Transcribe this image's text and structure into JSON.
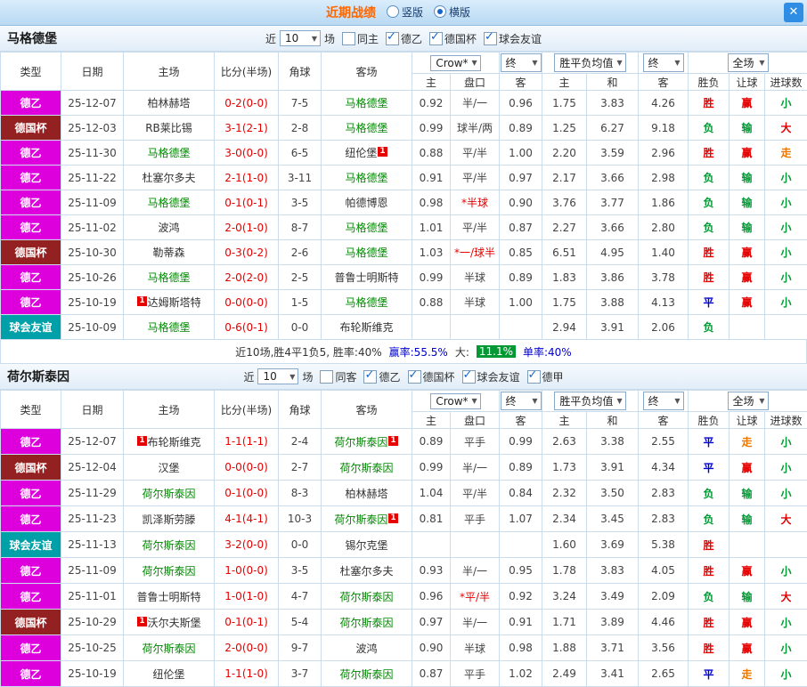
{
  "accent": {
    "score_red": "#e60000",
    "team_green": "#008800",
    "blue": "#0000cc"
  },
  "status_colors": {
    "胜": "#e60000",
    "负": "#009933",
    "平": "#0000cc",
    "赢": "#e60000",
    "输": "#009933",
    "走": "#ee7700",
    "大": "#e60000",
    "小": "#009933"
  },
  "type_styles": {
    "德乙": "#dd00dd",
    "德国杯": "#942121",
    "球会友谊": "#00a0a8"
  },
  "titlebar": {
    "title": "近期战绩",
    "radios": [
      {
        "label": "竖版",
        "selected": false
      },
      {
        "label": "横版",
        "selected": true
      }
    ],
    "close_label": "✕"
  },
  "table_header": {
    "type": "类型",
    "date": "日期",
    "home": "主场",
    "score": "比分(半场)",
    "corner": "角球",
    "away": "客场",
    "odds_select": "Crow*",
    "odds_final": "终",
    "odds_cols": [
      "主",
      "盘口",
      "客"
    ],
    "avg_select": "胜平负均值",
    "avg_final": "终",
    "avg_cols": [
      "主",
      "和",
      "客"
    ],
    "full_select": "全场",
    "result_cols": [
      "胜负",
      "让球",
      "进球数"
    ]
  },
  "sections": [
    {
      "team": "马格德堡",
      "filter": {
        "near": "近",
        "count": "10",
        "unit": "场",
        "checkboxes": [
          {
            "label": "同主",
            "checked": false
          },
          {
            "label": "德乙",
            "checked": true
          },
          {
            "label": "德国杯",
            "checked": true
          },
          {
            "label": "球会友谊",
            "checked": true
          }
        ]
      },
      "rows": [
        {
          "type": "德乙",
          "date": "25-12-07",
          "home": {
            "name": "柏林赫塔",
            "focus": false
          },
          "score": "0-2(0-0)",
          "corner": "7-5",
          "away": {
            "name": "马格德堡",
            "focus": true
          },
          "odds": [
            "0.92",
            "半/一",
            "0.96"
          ],
          "avg": [
            "1.75",
            "3.83",
            "4.26"
          ],
          "result": "胜",
          "let": "赢",
          "goal": "小"
        },
        {
          "type": "德国杯",
          "date": "25-12-03",
          "home": {
            "name": "RB莱比锡",
            "focus": false
          },
          "score": "3-1(2-1)",
          "corner": "2-8",
          "away": {
            "name": "马格德堡",
            "focus": true
          },
          "odds": [
            "0.99",
            "球半/两",
            "0.89"
          ],
          "avg": [
            "1.25",
            "6.27",
            "9.18"
          ],
          "result": "负",
          "let": "输",
          "goal": "大"
        },
        {
          "type": "德乙",
          "date": "25-11-30",
          "home": {
            "name": "马格德堡",
            "focus": true
          },
          "score": "3-0(0-0)",
          "corner": "6-5",
          "away": {
            "name": "纽伦堡",
            "focus": false,
            "badge": "1",
            "badge_pos": "after"
          },
          "odds": [
            "0.88",
            "平/半",
            "1.00"
          ],
          "avg": [
            "2.20",
            "3.59",
            "2.96"
          ],
          "result": "胜",
          "let": "赢",
          "goal": "走"
        },
        {
          "type": "德乙",
          "date": "25-11-22",
          "home": {
            "name": "杜塞尔多夫",
            "focus": false
          },
          "score": "2-1(1-0)",
          "corner": "3-11",
          "away": {
            "name": "马格德堡",
            "focus": true
          },
          "odds": [
            "0.91",
            "平/半",
            "0.97"
          ],
          "avg": [
            "2.17",
            "3.66",
            "2.98"
          ],
          "result": "负",
          "let": "输",
          "goal": "小"
        },
        {
          "type": "德乙",
          "date": "25-11-09",
          "home": {
            "name": "马格德堡",
            "focus": true
          },
          "score": "0-1(0-1)",
          "corner": "3-5",
          "away": {
            "name": "帕德博恩",
            "focus": false
          },
          "odds": [
            "0.98",
            "*半球",
            "0.90"
          ],
          "avg": [
            "3.76",
            "3.77",
            "1.86"
          ],
          "result": "负",
          "let": "输",
          "goal": "小"
        },
        {
          "type": "德乙",
          "date": "25-11-02",
          "home": {
            "name": "波鸿",
            "focus": false
          },
          "score": "2-0(1-0)",
          "corner": "8-7",
          "away": {
            "name": "马格德堡",
            "focus": true
          },
          "odds": [
            "1.01",
            "平/半",
            "0.87"
          ],
          "avg": [
            "2.27",
            "3.66",
            "2.80"
          ],
          "result": "负",
          "let": "输",
          "goal": "小"
        },
        {
          "type": "德国杯",
          "date": "25-10-30",
          "home": {
            "name": "勒蒂森",
            "focus": false
          },
          "score": "0-3(0-2)",
          "corner": "2-6",
          "away": {
            "name": "马格德堡",
            "focus": true
          },
          "odds": [
            "1.03",
            "*一/球半",
            "0.85"
          ],
          "avg": [
            "6.51",
            "4.95",
            "1.40"
          ],
          "result": "胜",
          "let": "赢",
          "goal": "小"
        },
        {
          "type": "德乙",
          "date": "25-10-26",
          "home": {
            "name": "马格德堡",
            "focus": true
          },
          "score": "2-0(2-0)",
          "corner": "2-5",
          "away": {
            "name": "普鲁士明斯特",
            "focus": false
          },
          "odds": [
            "0.99",
            "半球",
            "0.89"
          ],
          "avg": [
            "1.83",
            "3.86",
            "3.78"
          ],
          "result": "胜",
          "let": "赢",
          "goal": "小"
        },
        {
          "type": "德乙",
          "date": "25-10-19",
          "home": {
            "name": "达姆斯塔特",
            "focus": false,
            "badge": "1",
            "badge_pos": "before"
          },
          "score": "0-0(0-0)",
          "corner": "1-5",
          "away": {
            "name": "马格德堡",
            "focus": true
          },
          "odds": [
            "0.88",
            "半球",
            "1.00"
          ],
          "avg": [
            "1.75",
            "3.88",
            "4.13"
          ],
          "result": "平",
          "let": "赢",
          "goal": "小"
        },
        {
          "type": "球会友谊",
          "date": "25-10-09",
          "home": {
            "name": "马格德堡",
            "focus": true
          },
          "score": "0-6(0-1)",
          "corner": "0-0",
          "away": {
            "name": "布轮斯维克",
            "focus": false
          },
          "odds": [
            "",
            "",
            ""
          ],
          "avg": [
            "2.94",
            "3.91",
            "2.06"
          ],
          "result": "负",
          "let": "",
          "goal": ""
        }
      ],
      "summary": [
        {
          "text": "近10场,胜4平1负5, 胜率:40%",
          "color": "#333333"
        },
        {
          "text": "赢率:55.5%",
          "color": "#0000cc"
        },
        {
          "text": "大:",
          "color": "#333333"
        },
        {
          "text": "11.1%",
          "color": "#ffffff",
          "bg": "#009933"
        },
        {
          "text": "单率:40%",
          "color": "#0000cc"
        }
      ]
    },
    {
      "team": "荷尔斯泰因",
      "filter": {
        "near": "近",
        "count": "10",
        "unit": "场",
        "checkboxes": [
          {
            "label": "同客",
            "checked": false
          },
          {
            "label": "德乙",
            "checked": true
          },
          {
            "label": "德国杯",
            "checked": true
          },
          {
            "label": "球会友谊",
            "checked": true
          },
          {
            "label": "德甲",
            "checked": true
          }
        ]
      },
      "rows": [
        {
          "type": "德乙",
          "date": "25-12-07",
          "home": {
            "name": "布轮斯维克",
            "focus": false,
            "badge": "1",
            "badge_pos": "before"
          },
          "score": "1-1(1-1)",
          "corner": "2-4",
          "away": {
            "name": "荷尔斯泰因",
            "focus": true,
            "badge": "1",
            "badge_pos": "after"
          },
          "odds": [
            "0.89",
            "平手",
            "0.99"
          ],
          "avg": [
            "2.63",
            "3.38",
            "2.55"
          ],
          "result": "平",
          "let": "走",
          "goal": "小"
        },
        {
          "type": "德国杯",
          "date": "25-12-04",
          "home": {
            "name": "汉堡",
            "focus": false
          },
          "score": "0-0(0-0)",
          "corner": "2-7",
          "away": {
            "name": "荷尔斯泰因",
            "focus": true
          },
          "odds": [
            "0.99",
            "半/一",
            "0.89"
          ],
          "avg": [
            "1.73",
            "3.91",
            "4.34"
          ],
          "result": "平",
          "let": "赢",
          "goal": "小"
        },
        {
          "type": "德乙",
          "date": "25-11-29",
          "home": {
            "name": "荷尔斯泰因",
            "focus": true
          },
          "score": "0-1(0-0)",
          "corner": "8-3",
          "away": {
            "name": "柏林赫塔",
            "focus": false
          },
          "odds": [
            "1.04",
            "平/半",
            "0.84"
          ],
          "avg": [
            "2.32",
            "3.50",
            "2.83"
          ],
          "result": "负",
          "let": "输",
          "goal": "小"
        },
        {
          "type": "德乙",
          "date": "25-11-23",
          "home": {
            "name": "凯泽斯劳滕",
            "focus": false
          },
          "score": "4-1(4-1)",
          "corner": "10-3",
          "away": {
            "name": "荷尔斯泰因",
            "focus": true,
            "badge": "1",
            "badge_pos": "after"
          },
          "odds": [
            "0.81",
            "平手",
            "1.07"
          ],
          "avg": [
            "2.34",
            "3.45",
            "2.83"
          ],
          "result": "负",
          "let": "输",
          "goal": "大"
        },
        {
          "type": "球会友谊",
          "date": "25-11-13",
          "home": {
            "name": "荷尔斯泰因",
            "focus": true
          },
          "score": "3-2(0-0)",
          "corner": "0-0",
          "away": {
            "name": "锡尔克堡",
            "focus": false
          },
          "odds": [
            "",
            "",
            ""
          ],
          "avg": [
            "1.60",
            "3.69",
            "5.38"
          ],
          "result": "胜",
          "let": "",
          "goal": ""
        },
        {
          "type": "德乙",
          "date": "25-11-09",
          "home": {
            "name": "荷尔斯泰因",
            "focus": true
          },
          "score": "1-0(0-0)",
          "corner": "3-5",
          "away": {
            "name": "杜塞尔多夫",
            "focus": false
          },
          "odds": [
            "0.93",
            "半/一",
            "0.95"
          ],
          "avg": [
            "1.78",
            "3.83",
            "4.05"
          ],
          "result": "胜",
          "let": "赢",
          "goal": "小"
        },
        {
          "type": "德乙",
          "date": "25-11-01",
          "home": {
            "name": "普鲁士明斯特",
            "focus": false
          },
          "score": "1-0(1-0)",
          "corner": "4-7",
          "away": {
            "name": "荷尔斯泰因",
            "focus": true
          },
          "odds": [
            "0.96",
            "*平/半",
            "0.92"
          ],
          "avg": [
            "3.24",
            "3.49",
            "2.09"
          ],
          "result": "负",
          "let": "输",
          "goal": "大"
        },
        {
          "type": "德国杯",
          "date": "25-10-29",
          "home": {
            "name": "沃尔夫斯堡",
            "focus": false,
            "badge": "1",
            "badge_pos": "before"
          },
          "score": "0-1(0-1)",
          "corner": "5-4",
          "away": {
            "name": "荷尔斯泰因",
            "focus": true
          },
          "odds": [
            "0.97",
            "半/一",
            "0.91"
          ],
          "avg": [
            "1.71",
            "3.89",
            "4.46"
          ],
          "result": "胜",
          "let": "赢",
          "goal": "小"
        },
        {
          "type": "德乙",
          "date": "25-10-25",
          "home": {
            "name": "荷尔斯泰因",
            "focus": true
          },
          "score": "2-0(0-0)",
          "corner": "9-7",
          "away": {
            "name": "波鸿",
            "focus": false
          },
          "odds": [
            "0.90",
            "半球",
            "0.98"
          ],
          "avg": [
            "1.88",
            "3.71",
            "3.56"
          ],
          "result": "胜",
          "let": "赢",
          "goal": "小"
        },
        {
          "type": "德乙",
          "date": "25-10-19",
          "home": {
            "name": "纽伦堡",
            "focus": false
          },
          "score": "1-1(1-0)",
          "corner": "3-7",
          "away": {
            "name": "荷尔斯泰因",
            "focus": true
          },
          "odds": [
            "0.87",
            "平手",
            "1.02"
          ],
          "avg": [
            "2.49",
            "3.41",
            "2.65"
          ],
          "result": "平",
          "let": "走",
          "goal": "小"
        }
      ],
      "summary": null
    }
  ]
}
